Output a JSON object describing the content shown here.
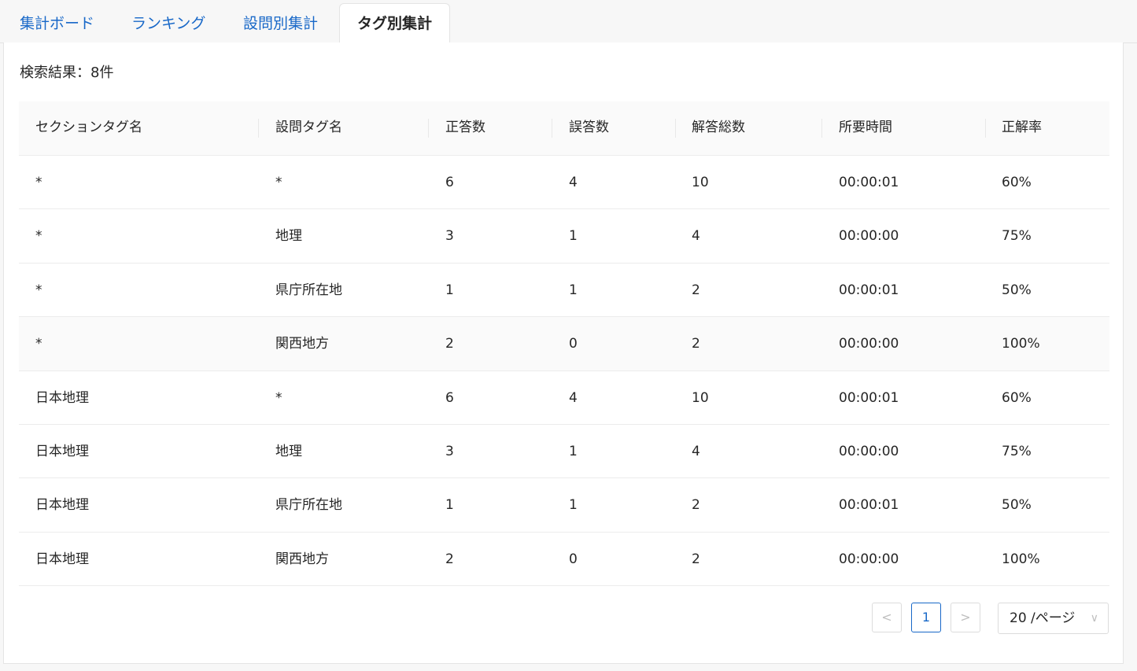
{
  "tabs": [
    {
      "label": "集計ボード",
      "active": false
    },
    {
      "label": "ランキング",
      "active": false
    },
    {
      "label": "設問別集計",
      "active": false
    },
    {
      "label": "タグ別集計",
      "active": true
    }
  ],
  "result_count": "検索結果：8件",
  "table": {
    "columns": [
      "セクションタグ名",
      "設問タグ名",
      "正答数",
      "誤答数",
      "解答総数",
      "所要時間",
      "正解率"
    ],
    "rows": [
      [
        "*",
        "*",
        "6",
        "4",
        "10",
        "00:00:01",
        "60%"
      ],
      [
        "*",
        "地理",
        "3",
        "1",
        "4",
        "00:00:00",
        "75%"
      ],
      [
        "*",
        "県庁所在地",
        "1",
        "1",
        "2",
        "00:00:01",
        "50%"
      ],
      [
        "*",
        "関西地方",
        "2",
        "0",
        "2",
        "00:00:00",
        "100%"
      ],
      [
        "日本地理",
        "*",
        "6",
        "4",
        "10",
        "00:00:01",
        "60%"
      ],
      [
        "日本地理",
        "地理",
        "3",
        "1",
        "4",
        "00:00:00",
        "75%"
      ],
      [
        "日本地理",
        "県庁所在地",
        "1",
        "1",
        "2",
        "00:00:01",
        "50%"
      ],
      [
        "日本地理",
        "関西地方",
        "2",
        "0",
        "2",
        "00:00:00",
        "100%"
      ]
    ],
    "hovered_row": 3
  },
  "pagination": {
    "prev_icon": "chevron-left-icon",
    "prev_glyph": "<",
    "current_page": "1",
    "next_icon": "chevron-right-icon",
    "next_glyph": ">",
    "page_size": "20 /ページ",
    "dropdown_icon": "chevron-down-icon",
    "dropdown_glyph": "∨"
  },
  "colors": {
    "accent": "#1868c8",
    "text": "#262626",
    "border": "#e4e4e4",
    "header_bg": "#fafafa"
  }
}
